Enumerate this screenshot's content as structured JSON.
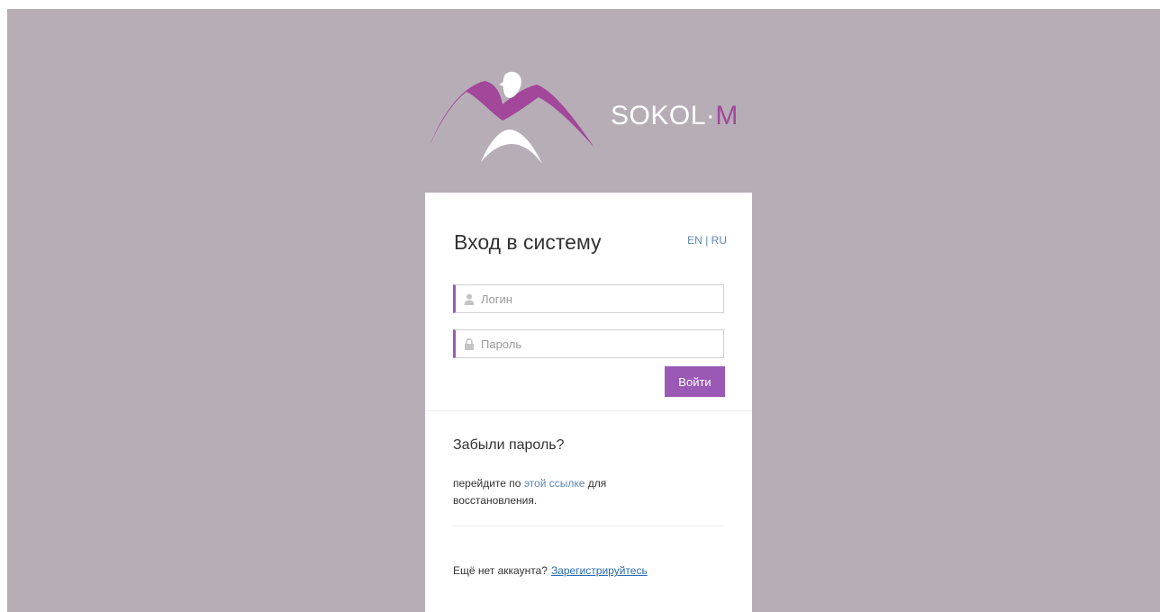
{
  "brand": {
    "name": "SOKOL",
    "separator": "·",
    "suffix": "M",
    "logo_icon": "falcon-logo-icon"
  },
  "colors": {
    "background": "#b7adb7",
    "accent": "#9b59b6",
    "logo_magenta": "#a2479a",
    "link": "#5b86b8"
  },
  "login": {
    "title": "Вход в систему",
    "lang_en": "EN",
    "lang_separator": "|",
    "lang_ru": "RU",
    "username_placeholder": "Логин",
    "username_icon": "user-icon",
    "password_placeholder": "Пароль",
    "password_icon": "lock-icon",
    "submit_label": "Войти"
  },
  "forgot": {
    "title": "Забыли пароль?",
    "text_before": "перейдите по",
    "link_label": "этой ссылке",
    "text_after": "для восстановления."
  },
  "register": {
    "prompt": "Ещё нет аккаунта?",
    "link_label": "Зарегистрируйтесь"
  }
}
